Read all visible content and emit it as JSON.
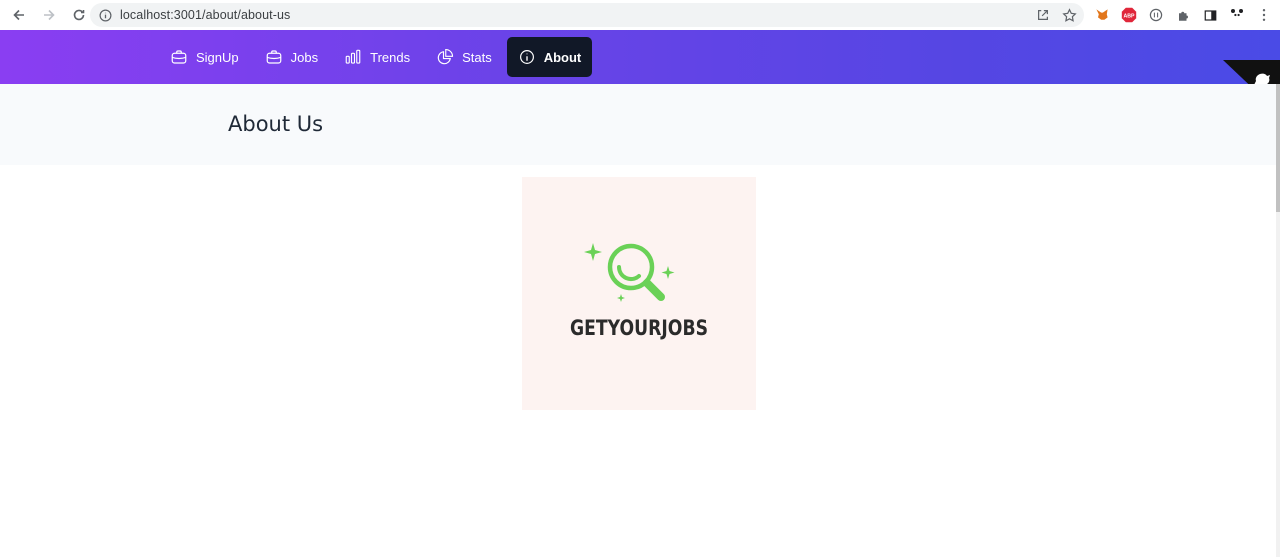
{
  "browser": {
    "url": "localhost:3001/about/about-us"
  },
  "nav": {
    "items": [
      {
        "label": "SignUp",
        "icon": "briefcase-icon"
      },
      {
        "label": "Jobs",
        "icon": "briefcase-icon"
      },
      {
        "label": "Trends",
        "icon": "bar-chart-icon"
      },
      {
        "label": "Stats",
        "icon": "pie-chart-icon"
      },
      {
        "label": "About",
        "icon": "info-icon",
        "active": true
      }
    ]
  },
  "page": {
    "title": "About Us"
  },
  "logo": {
    "text": "GETYOURJOBS",
    "accent": "#6ad157"
  },
  "colors": {
    "gradient_start": "#8a3ef2",
    "gradient_end": "#4a4be6",
    "active_tab": "#111827"
  }
}
